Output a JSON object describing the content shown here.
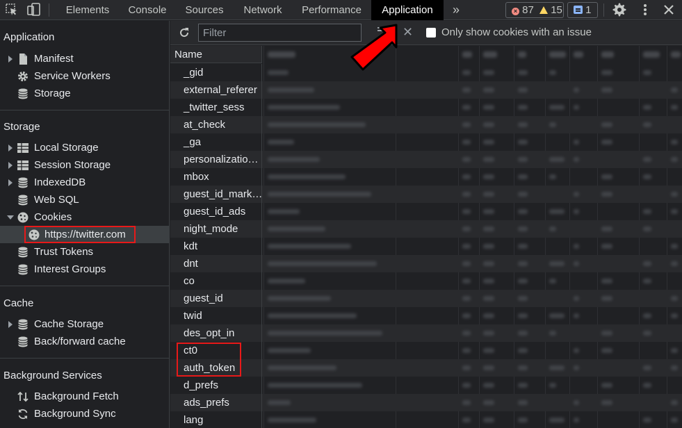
{
  "topbar": {
    "tabs": [
      "Elements",
      "Console",
      "Sources",
      "Network",
      "Performance",
      "Application"
    ],
    "active_tab": "Application",
    "more_glyph": "»",
    "error_count": "87",
    "warning_count": "15",
    "message_count": "1"
  },
  "sidebar": {
    "sections": {
      "application": "Application",
      "storage": "Storage",
      "cache": "Cache",
      "background": "Background Services"
    },
    "application_items": [
      "Manifest",
      "Service Workers",
      "Storage"
    ],
    "storage_items": [
      "Local Storage",
      "Session Storage",
      "IndexedDB",
      "Web SQL",
      "Cookies",
      "https://twitter.com",
      "Trust Tokens",
      "Interest Groups"
    ],
    "cache_items": [
      "Cache Storage",
      "Back/forward cache"
    ],
    "background_items": [
      "Background Fetch",
      "Background Sync"
    ]
  },
  "toolbar": {
    "filter_placeholder": "Filter",
    "clear_glyph": "✕",
    "only_issues_label": "Only show cookies with an issue"
  },
  "table": {
    "name_header": "Name",
    "rows": [
      "_gid",
      "external_referer",
      "_twitter_sess",
      "at_check",
      "_ga",
      "personalizatio…",
      "mbox",
      "guest_id_mark…",
      "guest_id_ads",
      "night_mode",
      "kdt",
      "dnt",
      "co",
      "guest_id",
      "twid",
      "des_opt_in",
      "ct0",
      "auth_token",
      "d_prefs",
      "ads_prefs",
      "lang"
    ]
  },
  "colors": {
    "highlight": "#e81919",
    "annotation_arrow": "#ff0000",
    "panel_bg": "#202124"
  }
}
